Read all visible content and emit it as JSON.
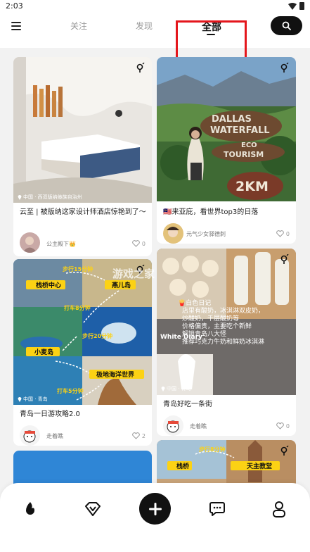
{
  "status_bar": {
    "time": "2:03"
  },
  "nav": {
    "tabs": [
      {
        "label": "关注"
      },
      {
        "label": "发现"
      },
      {
        "label": "全部"
      }
    ],
    "active_tab": "全部",
    "search_icon": "search-icon",
    "menu_icon": "menu-icon"
  },
  "cards": [
    {
      "location": "中国 · 西双版纳傣族自治州",
      "title": "云至 | 被版纳这家设计师酒店惊艳到了～",
      "author": "公主殿下👑",
      "likes": "0"
    },
    {
      "title": "🇲🇾来亚庇，看世界top3的日落",
      "author": "元气少女驿德刺",
      "likes": "0",
      "sign_lines": [
        "DALLAS",
        "WATERFALL",
        "ECO",
        "TOURISM",
        "2KM"
      ]
    },
    {
      "location": "中国 · 青岛",
      "title": "青岛一日游攻略2.0",
      "author": "走着瞧",
      "likes": "2",
      "map_labels": [
        "步行15分钟",
        "栈桥中心",
        "燕儿岛",
        "打车8分钟",
        "步行20分钟",
        "小麦岛",
        "极地海洋世界",
        "打车5分钟"
      ]
    },
    {
      "location": "中国 · 青岛",
      "title": "青岛好吃一条街",
      "author": "走着瞧",
      "likes": "0",
      "overlay_lines": [
        "🍟白色日记",
        "店里有酸奶，冰淇淋双皮奶，",
        "炒酸奶，千层酸奶等",
        "价格偏贵，主要吃个新鲜",
        "解锁青岛八大怪",
        "推荐巧克力牛奶和鲜奶冰淇淋"
      ]
    },
    {
      "map_labels": [
        "步行8分钟",
        "栈桥",
        "天主教堂"
      ]
    }
  ],
  "watermark": "游戏之家",
  "bottom_bar": {
    "items": [
      "fire-icon",
      "diamond-icon",
      "add-icon",
      "message-icon",
      "profile-icon"
    ]
  },
  "colors": {
    "accent": "#111111",
    "highlight": "#e4161c",
    "map_label_bg": "#fcd214"
  }
}
